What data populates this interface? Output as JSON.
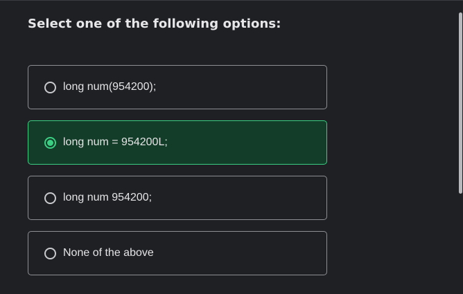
{
  "question": "Select one of the following options:",
  "options": [
    {
      "label": "long num(954200);",
      "selected": false
    },
    {
      "label": "long num = 954200L;",
      "selected": true
    },
    {
      "label": "long num 954200;",
      "selected": false
    },
    {
      "label": "None of the above",
      "selected": false
    }
  ],
  "colors": {
    "background": "#1f2024",
    "selected_bg": "#133d28",
    "accent": "#3bcf83"
  }
}
